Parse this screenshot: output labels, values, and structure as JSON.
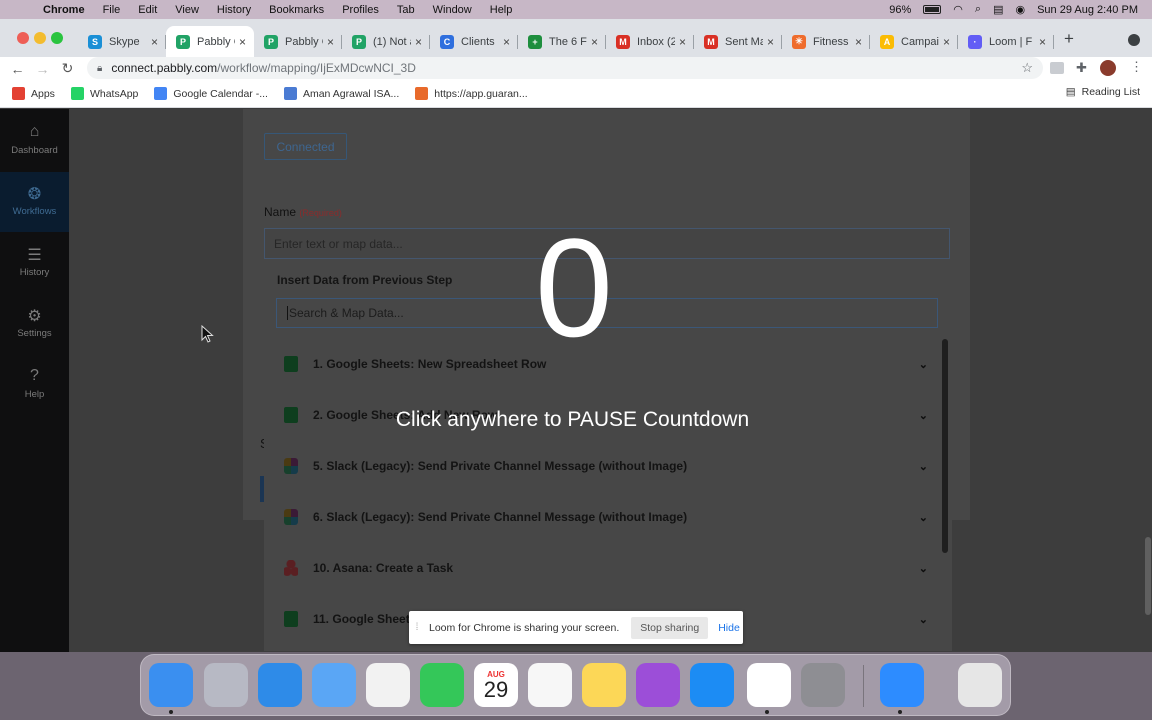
{
  "menubar": {
    "app": "Chrome",
    "items": [
      "File",
      "Edit",
      "View",
      "History",
      "Bookmarks",
      "Profiles",
      "Tab",
      "Window",
      "Help"
    ],
    "battery": "96%",
    "datetime": "Sun 29 Aug  2:40 PM"
  },
  "tabs": [
    {
      "label": "Skype",
      "icon_color": "#1a8fd6",
      "glyph": "S"
    },
    {
      "label": "Pabbly C",
      "icon_color": "#21a366",
      "glyph": "P",
      "active": true
    },
    {
      "label": "Pabbly C",
      "icon_color": "#21a366",
      "glyph": "P"
    },
    {
      "label": "(1) Not a",
      "icon_color": "#21a366",
      "glyph": "P"
    },
    {
      "label": "Clients",
      "icon_color": "#2f6fde",
      "glyph": "C"
    },
    {
      "label": "The 6 Fi",
      "icon_color": "#1e8e3e",
      "glyph": "+"
    },
    {
      "label": "Inbox (2",
      "icon_color": "#d93025",
      "glyph": "M"
    },
    {
      "label": "Sent Ma",
      "icon_color": "#d93025",
      "glyph": "M"
    },
    {
      "label": "Fitness",
      "icon_color": "#ef6c2c",
      "glyph": "✳"
    },
    {
      "label": "Campaig",
      "icon_color": "#fbbc04",
      "glyph": "A"
    },
    {
      "label": "Loom | F",
      "icon_color": "#625df5",
      "glyph": "·"
    }
  ],
  "omnibox": {
    "host": "connect.pabbly.com",
    "path": "/workflow/mapping/IjExMDcwNCI_3D"
  },
  "bookmarks": [
    {
      "label": "Apps",
      "color": "#e34133"
    },
    {
      "label": "WhatsApp",
      "color": "#25d366"
    },
    {
      "label": "Google Calendar -...",
      "color": "#4285f4"
    },
    {
      "label": "Aman Agrawal ISA...",
      "color": "#4a7bd3"
    },
    {
      "label": "https://app.guaran...",
      "color": "#e86a2b"
    }
  ],
  "reading_list": "Reading List",
  "sidebar": [
    {
      "label": "Dashboard",
      "icon": "home-icon",
      "glyph": "⌂"
    },
    {
      "label": "Workflows",
      "icon": "workflows-icon",
      "glyph": "❂",
      "active": true
    },
    {
      "label": "History",
      "icon": "history-icon",
      "glyph": "☰"
    },
    {
      "label": "Settings",
      "icon": "gear-icon",
      "glyph": "⚙"
    },
    {
      "label": "Help",
      "icon": "help-icon",
      "glyph": "?"
    }
  ],
  "form": {
    "connected_label": "Connected",
    "name_label": "Name",
    "required_label": "(Required)",
    "name_placeholder": "Enter text or map data...",
    "side_letter": "S"
  },
  "dropdown": {
    "title": "Insert Data from Previous Step",
    "search_placeholder": "Search & Map Data...",
    "items": [
      {
        "label": "1. Google Sheets: New Spreadsheet Row",
        "icon": "sheet"
      },
      {
        "label": "2. Google Sheets: Add New Row",
        "icon": "sheet"
      },
      {
        "label": "5. Slack (Legacy): Send Private Channel Message (without Image)",
        "icon": "slack"
      },
      {
        "label": "6. Slack (Legacy): Send Private Channel Message (without Image)",
        "icon": "slack"
      },
      {
        "label": "10. Asana: Create a Task",
        "icon": "asana"
      },
      {
        "label": "11. Google Sheets",
        "icon": "sheet"
      }
    ]
  },
  "overlay": {
    "countdown": "0",
    "message": "Click anywhere to PAUSE Countdown"
  },
  "loom": {
    "message": "Loom for Chrome is sharing your screen.",
    "stop": "Stop sharing",
    "hide": "Hide"
  },
  "dock": [
    {
      "name": "finder-icon",
      "color": "#3a8ff0"
    },
    {
      "name": "launchpad-icon",
      "color": "#b7b9c4"
    },
    {
      "name": "safari-icon",
      "color": "#2e8be8"
    },
    {
      "name": "mail-icon",
      "color": "#5aa6f5"
    },
    {
      "name": "photos-icon",
      "color": "#f2f2f2"
    },
    {
      "name": "facetime-icon",
      "color": "#34c759"
    },
    {
      "name": "calendar-icon",
      "color": "#ffffff",
      "month": "AUG",
      "day": "29"
    },
    {
      "name": "reminders-icon",
      "color": "#f7f7f7"
    },
    {
      "name": "notes-icon",
      "color": "#fcd757"
    },
    {
      "name": "podcasts-icon",
      "color": "#9c4ed8"
    },
    {
      "name": "app-store-icon",
      "color": "#1c8cf4"
    },
    {
      "name": "chrome-icon",
      "color": "#ffffff"
    },
    {
      "name": "system-preferences-icon",
      "color": "#8e8e93"
    },
    {
      "name": "zoom-icon",
      "color": "#2d8cff"
    },
    {
      "name": "trash-icon",
      "color": "#e6e6e6"
    }
  ]
}
